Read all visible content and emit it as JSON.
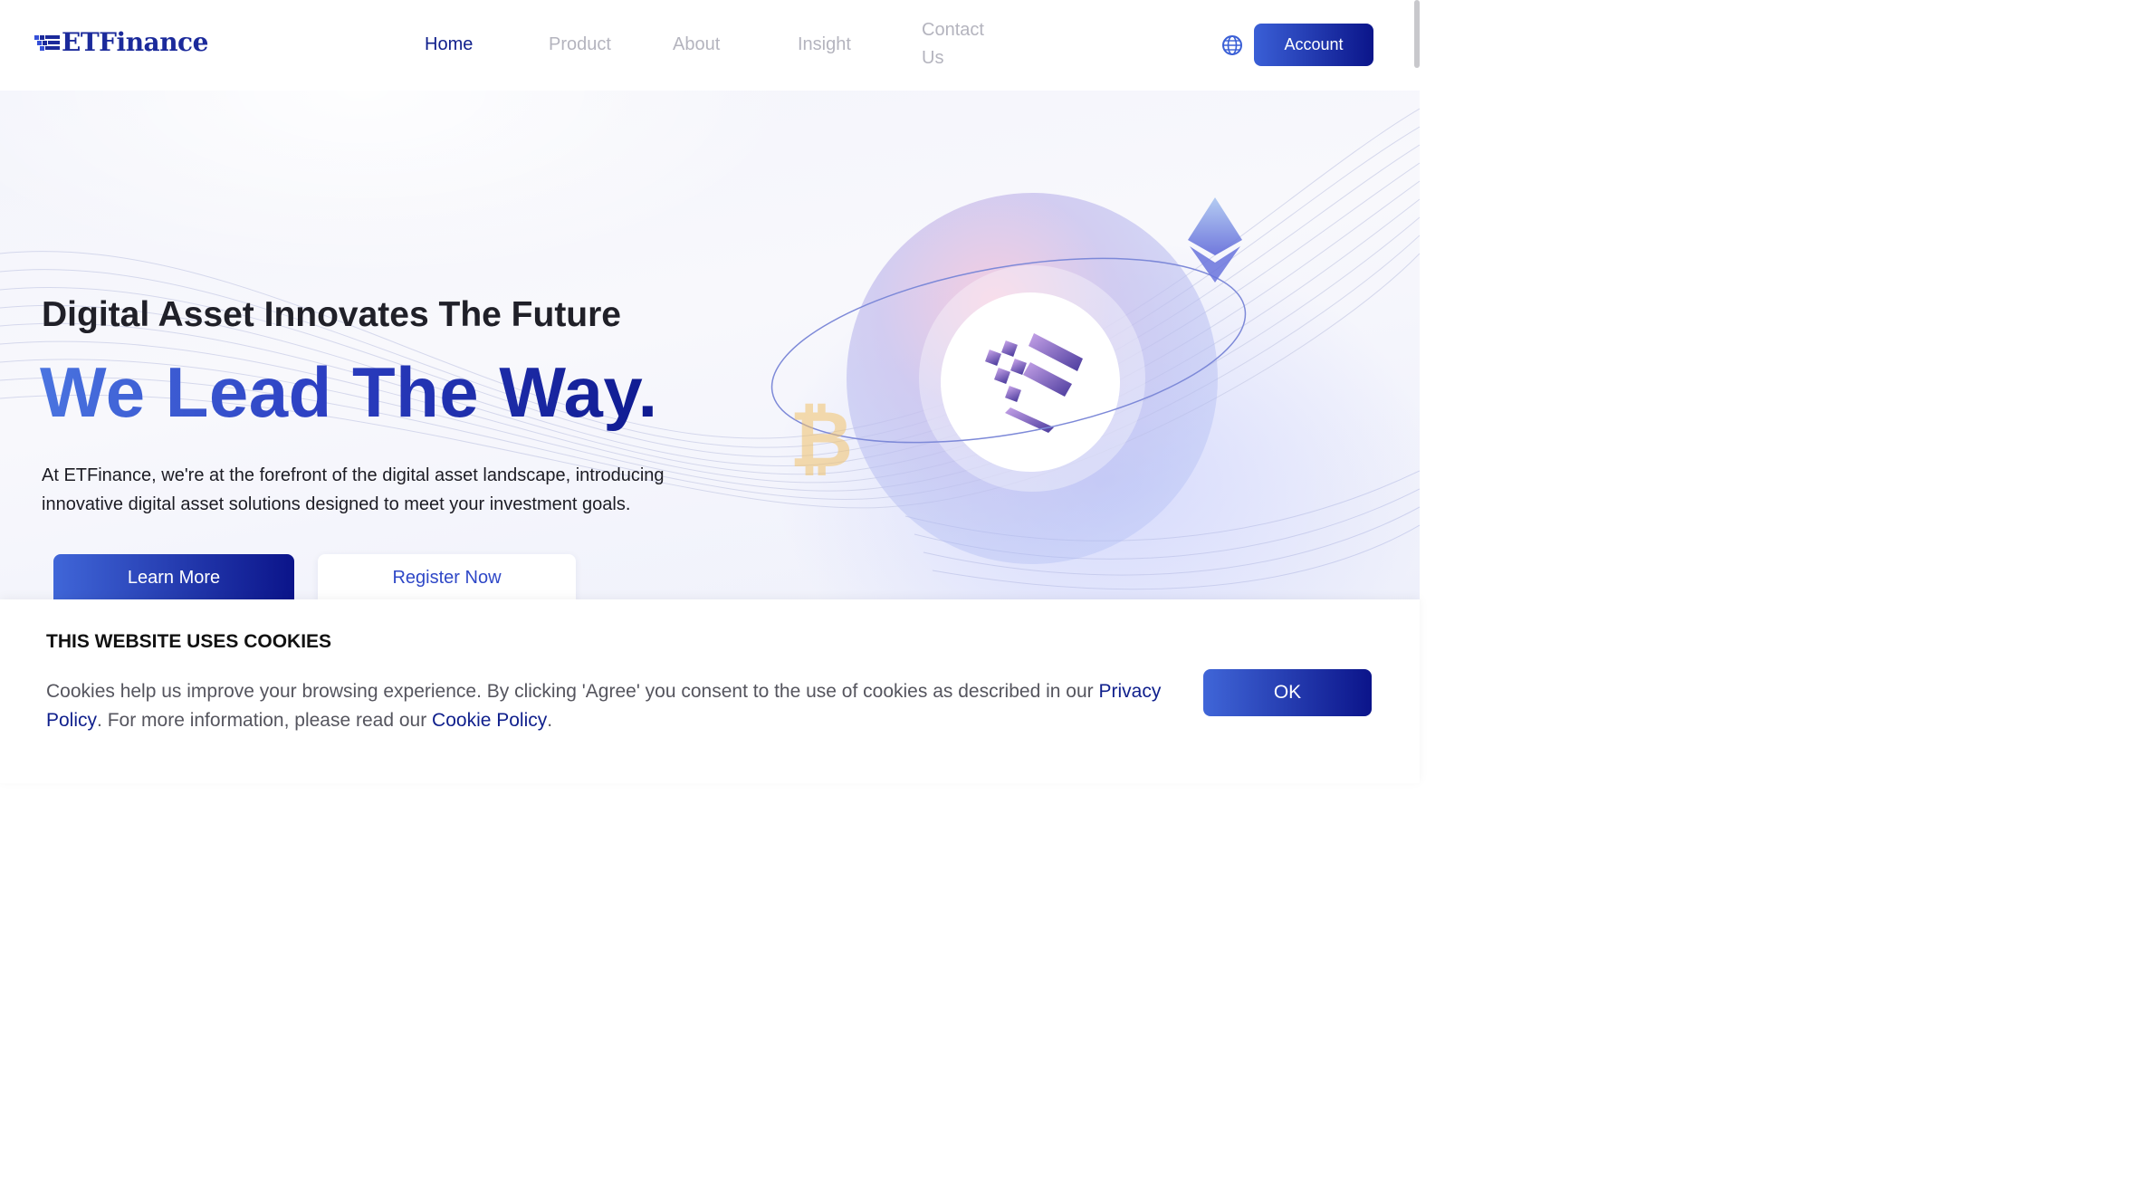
{
  "header": {
    "logo_text": "ETFinance",
    "nav": [
      {
        "label": "Home",
        "active": true
      },
      {
        "label": "Product",
        "active": false
      },
      {
        "label": "About",
        "active": false
      },
      {
        "label": "Insight",
        "active": false
      },
      {
        "label": "Contact Us",
        "active": false
      }
    ],
    "language_icon": "globe-icon",
    "account_label": "Account"
  },
  "hero": {
    "subtitle": "Digital Asset Innovates The Future",
    "title": "We Lead The Way.",
    "description": "At ETFinance, we're at the forefront of the digital asset landscape, introducing innovative digital asset solutions designed to meet your investment goals.",
    "learn_more_label": "Learn More",
    "register_label": "Register Now",
    "illustration": {
      "center_icon": "etfinance-logo-icon",
      "coin_left": "bitcoin-icon",
      "coin_right": "ethereum-icon"
    }
  },
  "cookie_banner": {
    "title": "THIS WEBSITE USES COOKIES",
    "text_before": "Cookies help us improve your browsing experience. By clicking 'Agree' you consent to the use of cookies as described in our ",
    "privacy_link": "Privacy Policy",
    "text_middle": ". For more information, please read our ",
    "cookie_link": "Cookie Policy",
    "text_after": ".",
    "ok_label": "OK"
  },
  "colors": {
    "brand": "#1b2a9b",
    "accent_start": "#4066d8",
    "accent_end": "#0b148a",
    "nav_inactive": "#b4b4be"
  }
}
